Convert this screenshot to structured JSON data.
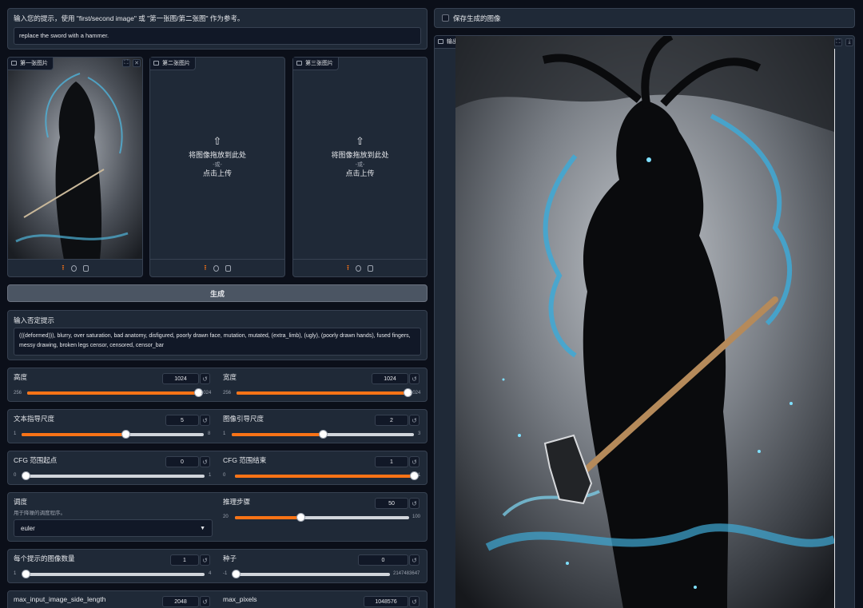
{
  "prompt": {
    "label": "输入您的提示，使用 \"first/second image\" 或 \"第一张图/第二张图\" 作为参考。",
    "value": "replace the sword with a hammer."
  },
  "images": [
    {
      "tag": "第一张图片"
    },
    {
      "tag": "第二张图片",
      "drop": "将图像拖放到此处",
      "or": "-或-",
      "click": "点击上传"
    },
    {
      "tag": "第三张图片",
      "drop": "将图像拖放到此处",
      "or": "-或-",
      "click": "点击上传"
    }
  ],
  "generate_label": "生成",
  "negative": {
    "label": "输入否定提示",
    "value": "(((deformed))), blurry, over saturation, bad anatomy, disfigured, poorly drawn face, mutation, mutated, (extra_limb), (ugly), (poorly drawn hands), fused fingers, messy drawing, broken legs censor, censored, censor_bar"
  },
  "sliders": {
    "height": {
      "label": "高度",
      "value": "1024",
      "min": "256",
      "max": "1024",
      "frac": 1.0
    },
    "width": {
      "label": "宽度",
      "value": "1024",
      "min": "256",
      "max": "1024",
      "frac": 1.0
    },
    "text_guidance": {
      "label": "文本指导尺度",
      "value": "5",
      "min": "1",
      "max": "8",
      "frac": 0.571
    },
    "image_guidance": {
      "label": "图像引导尺度",
      "value": "2",
      "min": "1",
      "max": "3",
      "frac": 0.5
    },
    "cfg_start": {
      "label": "CFG 范围起点",
      "value": "0",
      "min": "0",
      "max": "1",
      "frac": 0.0
    },
    "cfg_end": {
      "label": "CFG 范围结束",
      "value": "1",
      "min": "0",
      "max": "1",
      "frac": 1.0
    },
    "steps": {
      "label": "推理步骤",
      "value": "50",
      "min": "20",
      "max": "100",
      "frac": 0.375
    },
    "num_images": {
      "label": "每个提示的图像数量",
      "value": "1",
      "min": "1",
      "max": "4",
      "frac": 0.0
    },
    "seed": {
      "label": "种子",
      "value": "0",
      "min": "-1",
      "max": "2147483647",
      "frac": 0.0
    },
    "max_side": {
      "label": "max_input_image_side_length",
      "value": "2048"
    },
    "max_pixels": {
      "label": "max_pixels",
      "value": "1048576"
    }
  },
  "scheduler": {
    "label": "调度",
    "sub": "用于降噪的调度程序。",
    "value": "euler"
  },
  "save_label": "保存生成的图像",
  "output_tag": "输出图像",
  "reset_glyph": "↺",
  "colors": {
    "accent": "#f97316",
    "background": "#0b0f19",
    "panel": "#1f2937"
  }
}
